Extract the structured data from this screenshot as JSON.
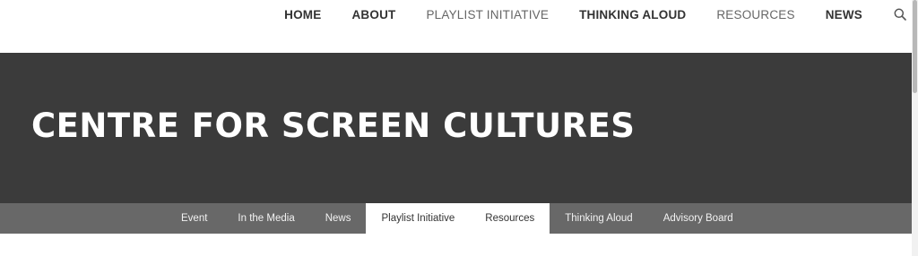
{
  "top_nav": {
    "items": [
      {
        "label": "HOME"
      },
      {
        "label": "ABOUT"
      },
      {
        "label": "PLAYLIST INITIATIVE"
      },
      {
        "label": "THINKING ALOUD"
      },
      {
        "label": "RESOURCES"
      },
      {
        "label": "NEWS"
      }
    ],
    "search_icon": "search-icon"
  },
  "hero": {
    "title": "CENTRE FOR SCREEN CULTURES",
    "background": "#3b3b3b"
  },
  "sub_nav": {
    "items": [
      {
        "label": "Event"
      },
      {
        "label": "In the Media"
      },
      {
        "label": "News"
      },
      {
        "label": "Playlist Initiative"
      },
      {
        "label": "Resources"
      },
      {
        "label": "Thinking Aloud"
      },
      {
        "label": "Advisory Board"
      }
    ],
    "highlighted": [
      "Playlist Initiative",
      "Resources"
    ],
    "background": "#686868"
  }
}
